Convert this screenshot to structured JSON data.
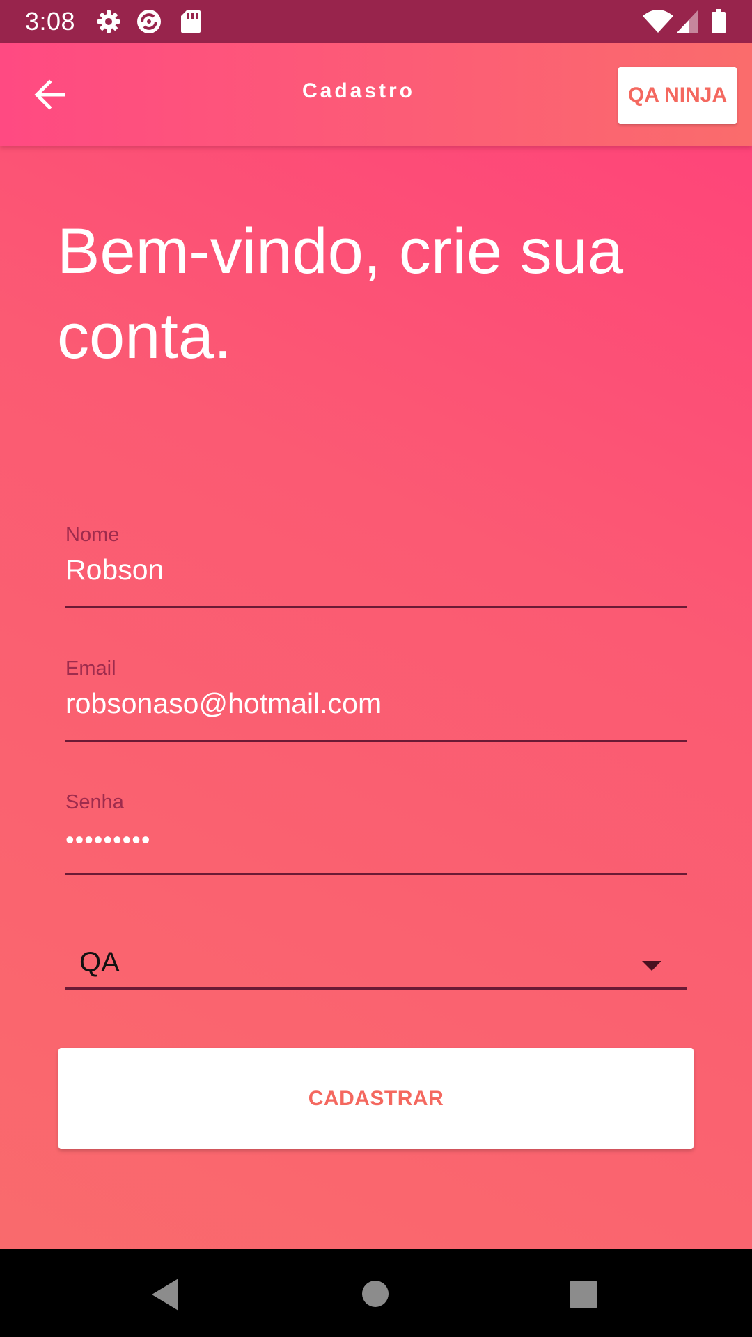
{
  "status_bar": {
    "time": "3:08",
    "icons": [
      "gear-icon",
      "sync-icon",
      "sd-card-icon",
      "wifi-icon",
      "signal-icon",
      "battery-icon"
    ]
  },
  "app_bar": {
    "back_icon": "arrow-left-icon",
    "title": "Cadastro",
    "action_label": "QA NINJA"
  },
  "heading": "Bem-vindo, crie sua conta.",
  "form": {
    "name": {
      "label": "Nome",
      "value": "Robson"
    },
    "email": {
      "label": "Email",
      "value": "robsonaso@hotmail.com"
    },
    "password": {
      "label": "Senha",
      "masked_value": "•••••••••"
    },
    "role": {
      "selected": "QA"
    },
    "submit_label": "CADASTRAR"
  },
  "nav_bar": {
    "icons": [
      "nav-back-icon",
      "nav-home-icon",
      "nav-recents-icon"
    ]
  },
  "colors": {
    "status_bar": "#98244c",
    "accent_text": "#f4685f",
    "gradient_start": "#ff3f7b",
    "gradient_end": "#f96c6c"
  }
}
